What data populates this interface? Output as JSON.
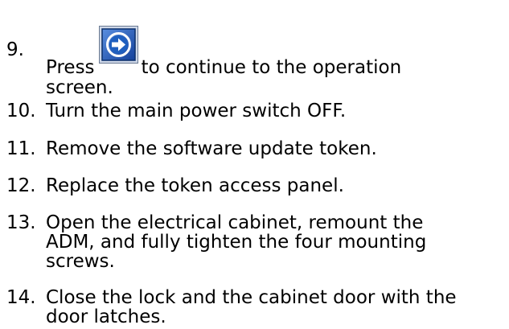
{
  "steps": [
    {
      "number": "9.",
      "lines_before_icon": "Press",
      "icon": "continue-arrow-icon",
      "lines_after_icon": "to continue to the operation",
      "lines": [
        "screen."
      ]
    },
    {
      "number": "10.",
      "lines": [
        "Turn the main power switch OFF."
      ]
    },
    {
      "number": "11.",
      "lines": [
        "Remove the software update token."
      ]
    },
    {
      "number": "12.",
      "lines": [
        "Replace the token access panel."
      ]
    },
    {
      "number": "13.",
      "lines": [
        "Open the electrical cabinet, remount the",
        "ADM, and fully tighten the four mounting",
        "screws."
      ]
    },
    {
      "number": "14.",
      "lines": [
        "Close the lock and the cabinet door with the",
        "door latches."
      ]
    }
  ],
  "colors": {
    "icon_blue": "#1f5fbf",
    "icon_ring": "#ffffff",
    "icon_border": "#0b2f6b"
  }
}
